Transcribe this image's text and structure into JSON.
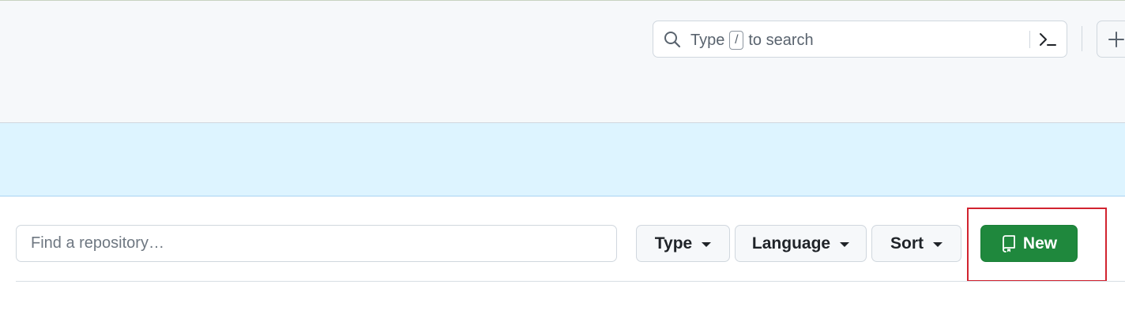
{
  "header": {
    "search": {
      "prefix": "Type",
      "shortcut_key": "/",
      "suffix": "to search"
    },
    "icons": {
      "search": "search-icon",
      "command_palette": "command-palette-icon",
      "create": "plus-icon"
    }
  },
  "repo_toolbar": {
    "search_placeholder": "Find a repository…",
    "filters": {
      "type_label": "Type",
      "language_label": "Language",
      "sort_label": "Sort"
    },
    "new_button_label": "New",
    "new_button_icon": "repo-icon"
  },
  "colors": {
    "header_bg": "#f6f8fa",
    "banner_bg": "#ddf4ff",
    "primary_button": "#1f883d",
    "highlight": "#d1232f"
  }
}
